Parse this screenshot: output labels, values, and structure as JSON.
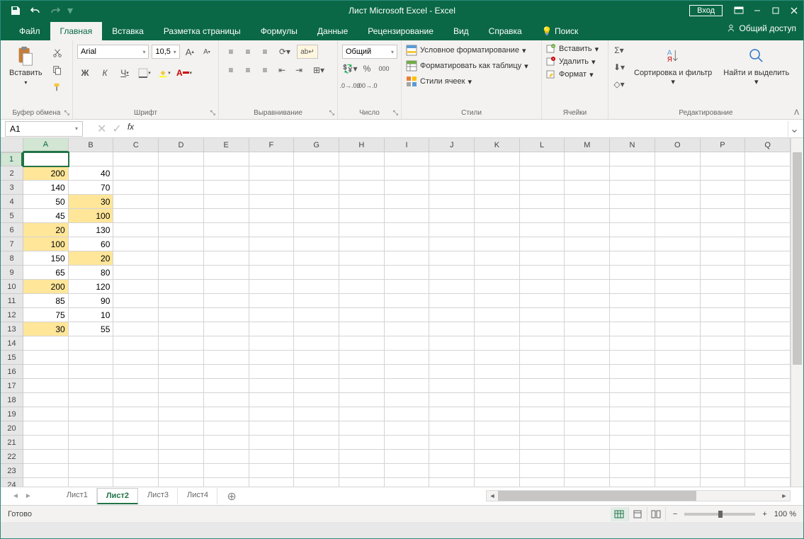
{
  "titlebar": {
    "title": "Лист Microsoft Excel  -  Excel",
    "signin": "Вход"
  },
  "tabs": {
    "file": "Файл",
    "home": "Главная",
    "insert": "Вставка",
    "layout": "Разметка страницы",
    "formulas": "Формулы",
    "data": "Данные",
    "review": "Рецензирование",
    "view": "Вид",
    "help": "Справка",
    "tellme": "Поиск",
    "share": "Общий доступ"
  },
  "ribbon": {
    "clipboard": {
      "paste": "Вставить",
      "label": "Буфер обмена"
    },
    "font": {
      "name": "Arial",
      "size": "10,5",
      "bold": "Ж",
      "italic": "К",
      "underline": "Ч",
      "label": "Шрифт"
    },
    "alignment": {
      "label": "Выравнивание",
      "wrap": "ab"
    },
    "number": {
      "format": "Общий",
      "label": "Число"
    },
    "styles": {
      "cond": "Условное форматирование",
      "table": "Форматировать как таблицу",
      "cell": "Стили ячеек",
      "label": "Стили"
    },
    "cells": {
      "insert": "Вставить",
      "delete": "Удалить",
      "format": "Формат",
      "label": "Ячейки"
    },
    "editing": {
      "sort": "Сортировка и фильтр",
      "find": "Найти и выделить",
      "label": "Редактирование"
    }
  },
  "formulabar": {
    "namebox": "A1"
  },
  "columns": [
    "A",
    "B",
    "C",
    "D",
    "E",
    "F",
    "G",
    "H",
    "I",
    "J",
    "K",
    "L",
    "M",
    "N",
    "O",
    "P",
    "Q"
  ],
  "cells": {
    "activeCol": 0,
    "activeRow": 1,
    "rows": [
      [
        {
          "v": "",
          "h": false
        },
        {
          "v": "",
          "h": false
        }
      ],
      [
        {
          "v": "200",
          "h": true
        },
        {
          "v": "40",
          "h": false
        }
      ],
      [
        {
          "v": "140",
          "h": false
        },
        {
          "v": "70",
          "h": false
        }
      ],
      [
        {
          "v": "50",
          "h": false
        },
        {
          "v": "30",
          "h": true
        }
      ],
      [
        {
          "v": "45",
          "h": false
        },
        {
          "v": "100",
          "h": true
        }
      ],
      [
        {
          "v": "20",
          "h": true
        },
        {
          "v": "130",
          "h": false
        }
      ],
      [
        {
          "v": "100",
          "h": true
        },
        {
          "v": "60",
          "h": false
        }
      ],
      [
        {
          "v": "150",
          "h": false
        },
        {
          "v": "20",
          "h": true
        }
      ],
      [
        {
          "v": "65",
          "h": false
        },
        {
          "v": "80",
          "h": false
        }
      ],
      [
        {
          "v": "200",
          "h": true
        },
        {
          "v": "120",
          "h": false
        }
      ],
      [
        {
          "v": "85",
          "h": false
        },
        {
          "v": "90",
          "h": false
        }
      ],
      [
        {
          "v": "75",
          "h": false
        },
        {
          "v": "10",
          "h": false
        }
      ],
      [
        {
          "v": "30",
          "h": true
        },
        {
          "v": "55",
          "h": false
        }
      ]
    ],
    "totalRows": 24
  },
  "sheets": {
    "tabs": [
      "Лист1",
      "Лист2",
      "Лист3",
      "Лист4"
    ],
    "active": 1
  },
  "statusbar": {
    "ready": "Готово",
    "zoom": "100 %"
  }
}
